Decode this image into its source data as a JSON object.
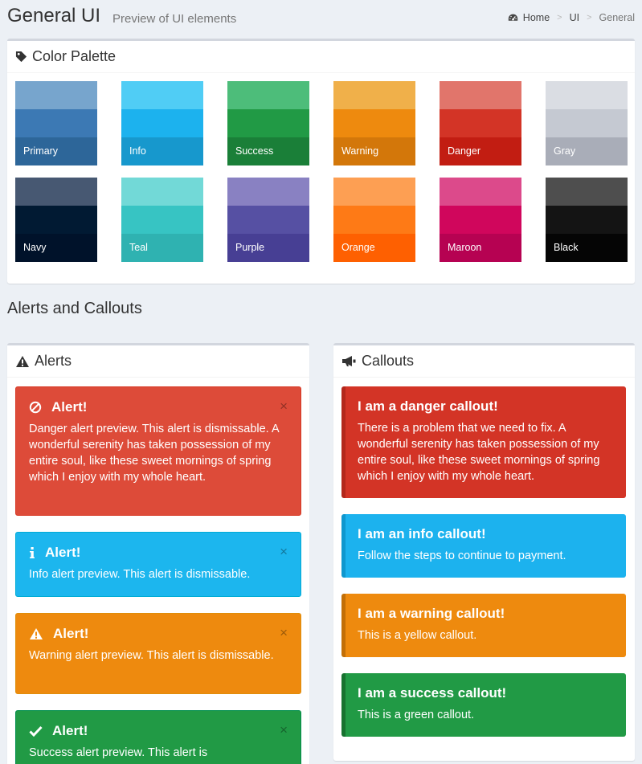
{
  "header": {
    "title": "General UI",
    "subtitle": "Preview of UI elements",
    "breadcrumb": [
      "Home",
      "UI",
      "General"
    ]
  },
  "palette": {
    "title": "Color Palette",
    "swatches": [
      {
        "label": "Primary",
        "colors": [
          "#77a5cd",
          "#3c79b4",
          "#2d6699"
        ]
      },
      {
        "label": "Info",
        "colors": [
          "#50cdf5",
          "#1cb2ee",
          "#1798cd"
        ]
      },
      {
        "label": "Success",
        "colors": [
          "#4dbd7a",
          "#219a45",
          "#1a7f38"
        ]
      },
      {
        "label": "Warning",
        "colors": [
          "#f0b04a",
          "#ee8a0e",
          "#d3770a"
        ]
      },
      {
        "label": "Danger",
        "colors": [
          "#e1756b",
          "#d33426",
          "#c21d12"
        ]
      },
      {
        "label": "Gray",
        "colors": [
          "#dadde3",
          "#c5c9d2",
          "#a9adb8"
        ]
      },
      {
        "label": "Navy",
        "colors": [
          "#475872",
          "#011a33",
          "#00122a"
        ]
      },
      {
        "label": "Teal",
        "colors": [
          "#72d9d7",
          "#37c4c3",
          "#2fb2b1"
        ]
      },
      {
        "label": "Purple",
        "colors": [
          "#8981c2",
          "#5650a3",
          "#473f94"
        ]
      },
      {
        "label": "Orange",
        "colors": [
          "#fd9f53",
          "#fe7a16",
          "#fe6001"
        ]
      },
      {
        "label": "Maroon",
        "colors": [
          "#dc4a8b",
          "#d0065c",
          "#b60252"
        ]
      },
      {
        "label": "Black",
        "colors": [
          "#4e4e4e",
          "#141414",
          "#050505"
        ]
      }
    ]
  },
  "section": {
    "title": "Alerts and Callouts"
  },
  "alerts": {
    "title": "Alerts",
    "items": [
      {
        "kind": "danger",
        "icon": "ban-icon",
        "title": "Alert!",
        "body": "Danger alert preview. This alert is dismissable. A wonderful serenity has taken possession of my entire soul, like these sweet mornings of spring which I enjoy with my whole heart."
      },
      {
        "kind": "info",
        "icon": "info-icon",
        "title": "Alert!",
        "body": "Info alert preview. This alert is dismissable."
      },
      {
        "kind": "warning",
        "icon": "warning-icon",
        "title": "Alert!",
        "body": "Warning alert preview. This alert is dismissable."
      },
      {
        "kind": "success",
        "icon": "check-icon",
        "title": "Alert!",
        "body": "Success alert preview. This alert is"
      }
    ],
    "close_glyph": "×"
  },
  "callouts": {
    "title": "Callouts",
    "items": [
      {
        "kind": "danger",
        "title": "I am a danger callout!",
        "body": "There is a problem that we need to fix. A wonderful serenity has taken possession of my entire soul, like these sweet mornings of spring which I enjoy with my whole heart."
      },
      {
        "kind": "info",
        "title": "I am an info callout!",
        "body": "Follow the steps to continue to payment."
      },
      {
        "kind": "warning",
        "title": "I am a warning callout!",
        "body": "This is a yellow callout."
      },
      {
        "kind": "success",
        "title": "I am a success callout!",
        "body": "This is a green callout."
      }
    ]
  }
}
